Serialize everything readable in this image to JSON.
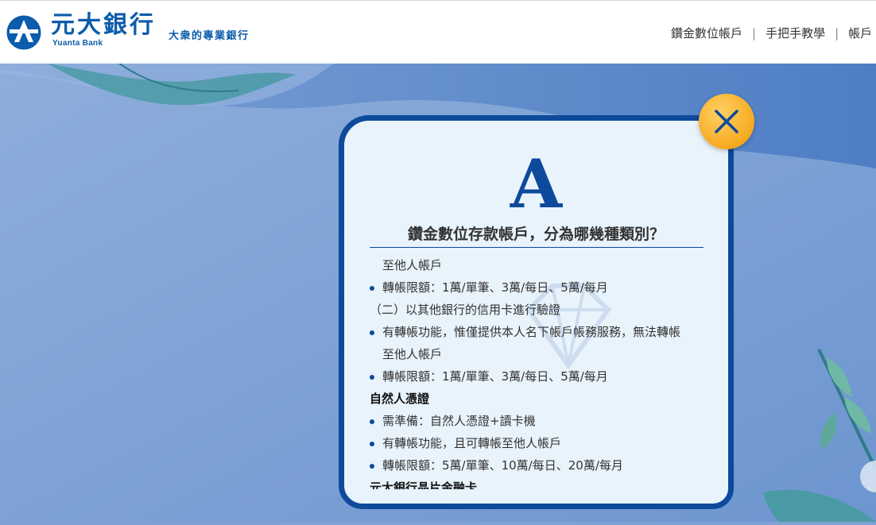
{
  "header": {
    "brand_name": "元大銀行",
    "brand_en": "Yuanta Bank",
    "slogan": "大衆的專業銀行",
    "nav": [
      "鑽金數位帳戶",
      "手把手教學",
      "帳戶"
    ]
  },
  "modal": {
    "letter": "A",
    "question": "鑽金數位存款帳戶，分為哪幾種類別？",
    "close_icon": "close-icon",
    "lines": [
      {
        "type": "indent",
        "text": "至他人帳戶"
      },
      {
        "type": "bullet",
        "text": "轉帳限額：1萬/單筆、3萬/每日、5萬/每月"
      },
      {
        "type": "plain",
        "text": "（二）以其他銀行的信用卡進行驗證"
      },
      {
        "type": "bullet",
        "text": "有轉帳功能，惟僅提供本人名下帳戶帳務服務，無法轉帳"
      },
      {
        "type": "indent",
        "text": "至他人帳戶"
      },
      {
        "type": "bullet",
        "text": "轉帳限額：1萬/單筆、3萬/每日、5萬/每月"
      },
      {
        "type": "heading",
        "text": "自然人憑證"
      },
      {
        "type": "bullet",
        "text": "需準備：自然人憑證+讀卡機"
      },
      {
        "type": "bullet",
        "text": "有轉帳功能，且可轉帳至他人帳戶"
      },
      {
        "type": "bullet",
        "text": "轉帳限額：5萬/單筆、10萬/每日、20萬/每月"
      },
      {
        "type": "heading",
        "text": "元大銀行晶片金融卡"
      }
    ]
  },
  "colors": {
    "brand_blue": "#0b5cab",
    "modal_border": "#0d4a9b",
    "modal_bg": "#e8f3fb",
    "close_button": "#f6a91f",
    "background": "#7ea2d4"
  }
}
